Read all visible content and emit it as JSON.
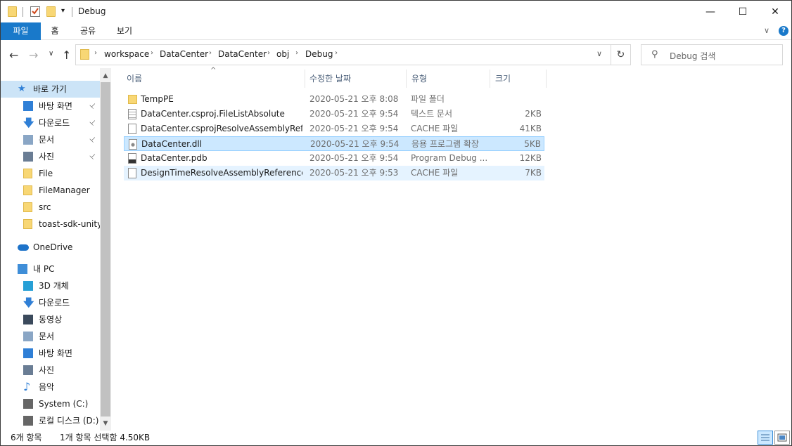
{
  "window": {
    "title": "Debug",
    "minimize_glyph": "—",
    "maximize_glyph": "☐",
    "close_glyph": "✕"
  },
  "ribbon": {
    "tabs": [
      {
        "label": "파일"
      },
      {
        "label": "홈"
      },
      {
        "label": "공유"
      },
      {
        "label": "보기"
      }
    ],
    "expand_glyph": "∨",
    "help_glyph": "?"
  },
  "nav": {
    "back": "←",
    "forward": "→",
    "recent": "∨",
    "up": "↑",
    "breadcrumbs": [
      "workspace",
      "DataCenter",
      "DataCenter",
      "obj",
      "Debug"
    ],
    "dropdown": "∨",
    "refresh": "↻",
    "search_placeholder": "Debug 검색"
  },
  "sidebar": {
    "items": [
      {
        "label": "바로 가기",
        "icon": "star-icon",
        "pinned": false
      },
      {
        "label": "바탕 화면",
        "icon": "desktop-icon",
        "pinned": true
      },
      {
        "label": "다운로드",
        "icon": "download-icon",
        "pinned": true
      },
      {
        "label": "문서",
        "icon": "document-icon",
        "pinned": true
      },
      {
        "label": "사진",
        "icon": "pictures-icon",
        "pinned": true
      },
      {
        "label": "File",
        "icon": "folder-icon",
        "pinned": false
      },
      {
        "label": "FileManager",
        "icon": "folder-icon",
        "pinned": false
      },
      {
        "label": "src",
        "icon": "folder-icon",
        "pinned": false
      },
      {
        "label": "toast-sdk-unity-",
        "icon": "folder-icon",
        "pinned": false
      },
      {
        "label": "OneDrive",
        "icon": "onedrive-icon",
        "pinned": false
      },
      {
        "label": "내 PC",
        "icon": "pc-icon",
        "pinned": false
      },
      {
        "label": "3D 개체",
        "icon": "3d-objects-icon",
        "pinned": false
      },
      {
        "label": "다운로드",
        "icon": "download-icon",
        "pinned": false
      },
      {
        "label": "동영상",
        "icon": "video-icon",
        "pinned": false
      },
      {
        "label": "문서",
        "icon": "document-icon",
        "pinned": false
      },
      {
        "label": "바탕 화면",
        "icon": "desktop-icon",
        "pinned": false
      },
      {
        "label": "사진",
        "icon": "pictures-icon",
        "pinned": false
      },
      {
        "label": "음악",
        "icon": "music-icon",
        "pinned": false
      },
      {
        "label": "System (C:)",
        "icon": "drive-c-icon",
        "pinned": false
      },
      {
        "label": "로컬 디스크 (D:)",
        "icon": "drive-d-icon",
        "pinned": false
      }
    ],
    "pin_glyph": "📌"
  },
  "columns": {
    "name": "이름",
    "date": "수정한 날짜",
    "type": "유형",
    "size": "크기"
  },
  "files": [
    {
      "name": "TempPE",
      "date": "2020-05-21 오후 8:08",
      "type": "파일 폴더",
      "size": "",
      "icon": "folder-icon"
    },
    {
      "name": "DataCenter.csproj.FileListAbsolute",
      "date": "2020-05-21 오후 9:54",
      "type": "텍스트 문서",
      "size": "2KB",
      "icon": "text-file-icon"
    },
    {
      "name": "DataCenter.csprojResolveAssemblyRefer...",
      "date": "2020-05-21 오후 9:54",
      "type": "CACHE 파일",
      "size": "41KB",
      "icon": "file-icon"
    },
    {
      "name": "DataCenter.dll",
      "date": "2020-05-21 오후 9:54",
      "type": "응용 프로그램 확장",
      "size": "5KB",
      "icon": "dll-icon"
    },
    {
      "name": "DataCenter.pdb",
      "date": "2020-05-21 오후 9:54",
      "type": "Program Debug ...",
      "size": "12KB",
      "icon": "pdb-icon"
    },
    {
      "name": "DesignTimeResolveAssemblyReferencesI...",
      "date": "2020-05-21 오후 9:53",
      "type": "CACHE 파일",
      "size": "7KB",
      "icon": "file-icon"
    }
  ],
  "status": {
    "count": "6개 항목",
    "selection": "1개 항목 선택함 4.50KB"
  }
}
